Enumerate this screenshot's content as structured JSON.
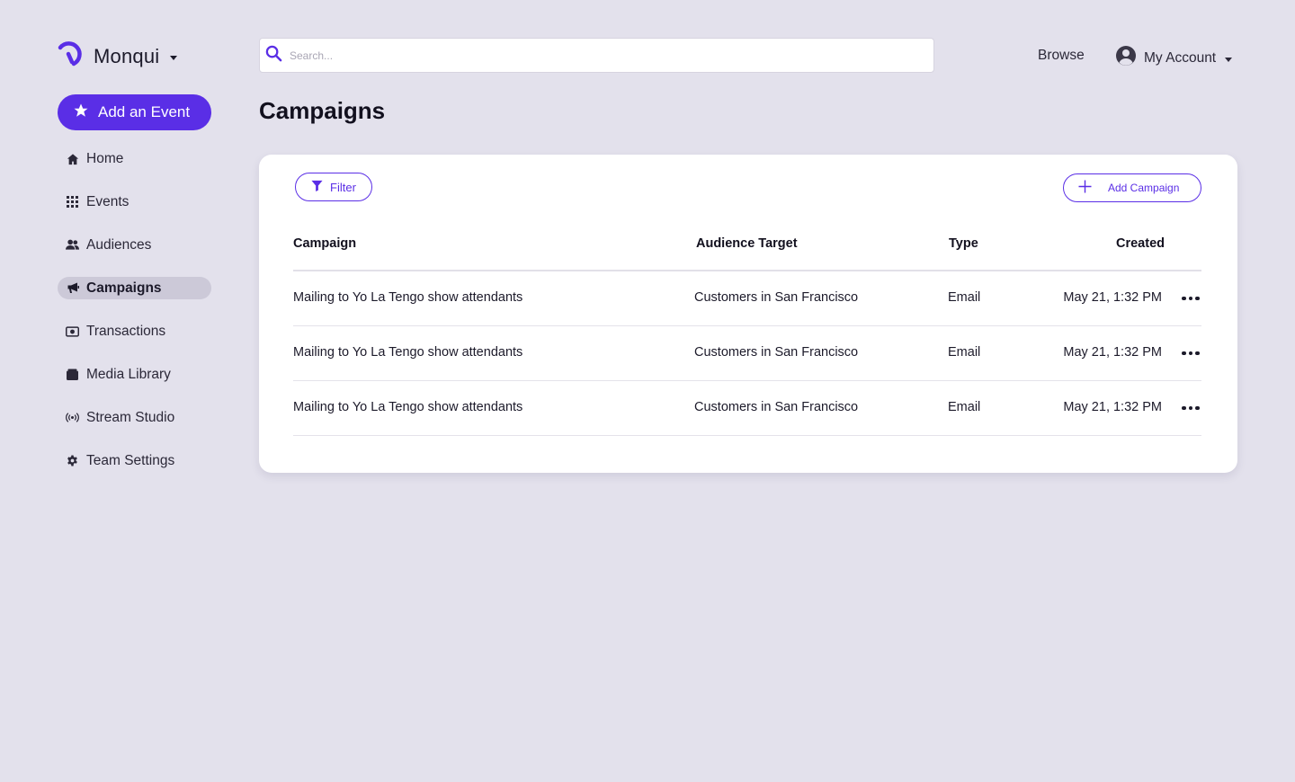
{
  "brand": {
    "name": "Monqui",
    "logo_icon": "monqui-logo-icon"
  },
  "add_event": {
    "label": "Add an Event",
    "icon": "star-icon"
  },
  "nav": {
    "items": [
      {
        "label": "Home",
        "icon": "home-icon",
        "active": false
      },
      {
        "label": "Events",
        "icon": "grid-icon",
        "active": false
      },
      {
        "label": "Audiences",
        "icon": "users-icon",
        "active": false
      },
      {
        "label": "Campaigns",
        "icon": "megaphone-icon",
        "active": true
      },
      {
        "label": "Transactions",
        "icon": "money-icon",
        "active": false
      },
      {
        "label": "Media Library",
        "icon": "folder-icon",
        "active": false
      },
      {
        "label": "Stream Studio",
        "icon": "broadcast-icon",
        "active": false
      },
      {
        "label": "Team Settings",
        "icon": "gear-icon",
        "active": false
      }
    ]
  },
  "search": {
    "placeholder": "Search...",
    "value": ""
  },
  "header": {
    "browse": "Browse",
    "account": "My Account"
  },
  "page": {
    "title": "Campaigns"
  },
  "toolbar": {
    "filter": "Filter",
    "add_campaign": "Add Campaign"
  },
  "table": {
    "columns": [
      "Campaign",
      "Audience Target",
      "Type",
      "Created"
    ],
    "rows": [
      {
        "campaign": "Mailing to Yo La Tengo show attendants",
        "audience": "Customers in San Francisco",
        "type": "Email",
        "created": "May 21, 1:32 PM"
      },
      {
        "campaign": "Mailing to Yo La Tengo show attendants",
        "audience": "Customers in San Francisco",
        "type": "Email",
        "created": "May 21, 1:32 PM"
      },
      {
        "campaign": "Mailing to Yo La Tengo show attendants",
        "audience": "Customers in San Francisco",
        "type": "Email",
        "created": "May 21, 1:32 PM"
      }
    ]
  },
  "colors": {
    "accent": "#5a2ee6",
    "background": "#e3e1ec",
    "active_nav": "#ccc9d8"
  }
}
